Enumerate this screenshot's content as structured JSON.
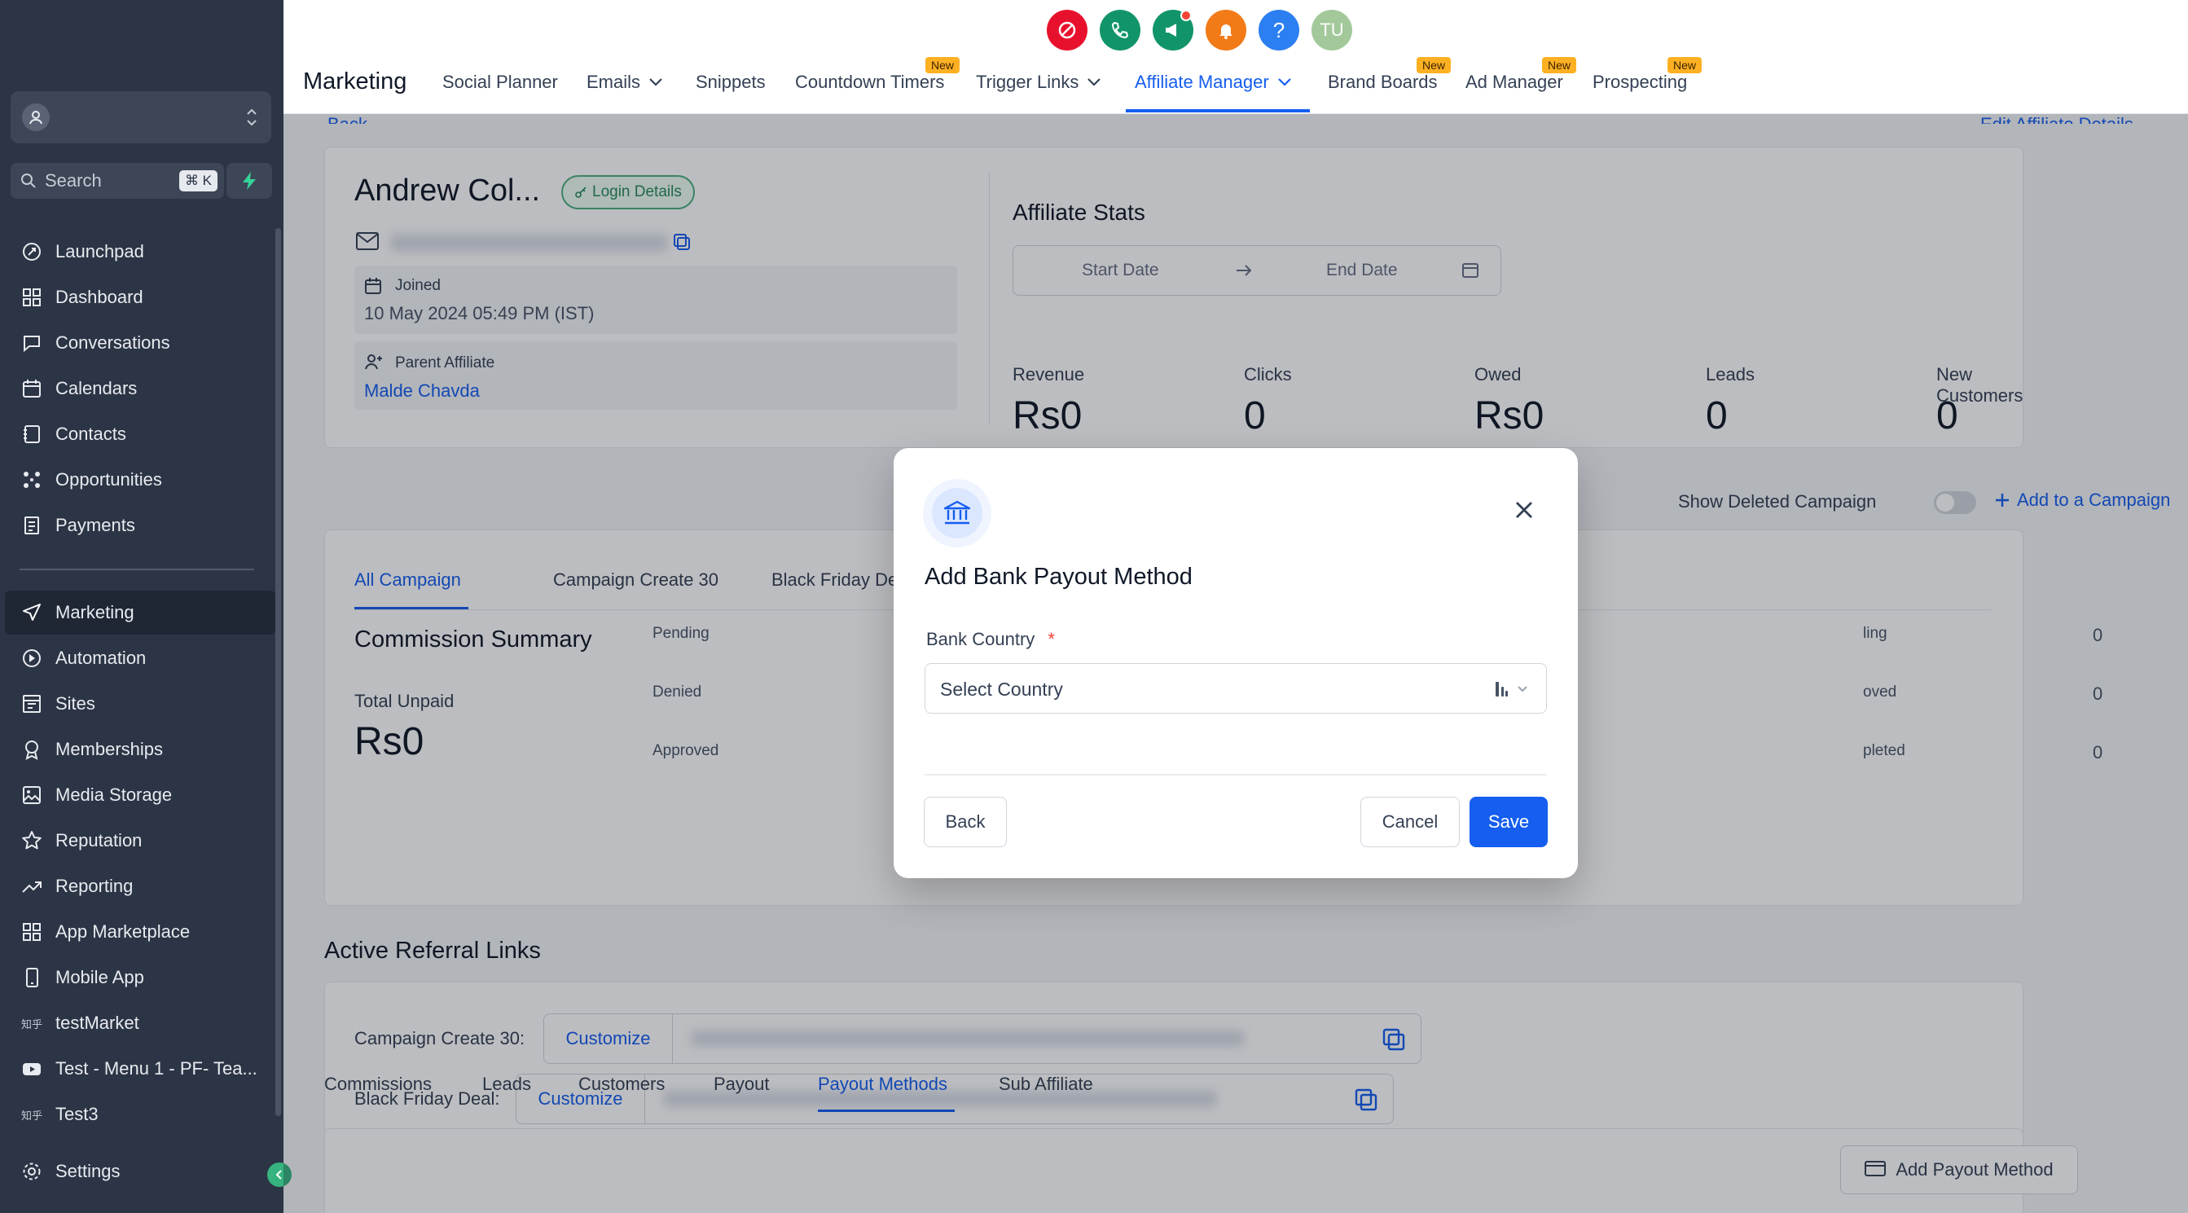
{
  "sidebar": {
    "search_label": "Search",
    "search_shortcut": "⌘ K",
    "items": [
      {
        "label": "Launchpad",
        "icon": "rocket-icon"
      },
      {
        "label": "Dashboard",
        "icon": "grid-icon"
      },
      {
        "label": "Conversations",
        "icon": "chat-icon"
      },
      {
        "label": "Calendars",
        "icon": "calendar-icon"
      },
      {
        "label": "Contacts",
        "icon": "contacts-icon"
      },
      {
        "label": "Opportunities",
        "icon": "opportunities-icon"
      },
      {
        "label": "Payments",
        "icon": "payments-icon"
      },
      {
        "label": "Marketing",
        "icon": "send-icon",
        "active": true
      },
      {
        "label": "Automation",
        "icon": "automation-icon"
      },
      {
        "label": "Sites",
        "icon": "sites-icon"
      },
      {
        "label": "Memberships",
        "icon": "memberships-icon"
      },
      {
        "label": "Media Storage",
        "icon": "image-icon"
      },
      {
        "label": "Reputation",
        "icon": "star-icon"
      },
      {
        "label": "Reporting",
        "icon": "trend-icon"
      },
      {
        "label": "App Marketplace",
        "icon": "apps-icon"
      },
      {
        "label": "Mobile App",
        "icon": "mobile-icon"
      },
      {
        "label": "testMarket",
        "icon": "text-icon"
      },
      {
        "label": "Test - Menu 1 - PF- Tea...",
        "icon": "youtube-icon"
      },
      {
        "label": "Test3",
        "icon": "text-icon"
      }
    ],
    "settings_label": "Settings",
    "chinese_glyph": "知乎"
  },
  "topnav": {
    "module_title": "Marketing",
    "tabs": [
      {
        "label": "Social Planner"
      },
      {
        "label": "Emails",
        "dropdown": true
      },
      {
        "label": "Snippets"
      },
      {
        "label": "Countdown Timers",
        "badge": "New"
      },
      {
        "label": "Trigger Links",
        "dropdown": true
      },
      {
        "label": "Affiliate Manager",
        "dropdown": true,
        "active": true
      },
      {
        "label": "Brand Boards",
        "badge": "New"
      },
      {
        "label": "Ad Manager",
        "badge": "New"
      },
      {
        "label": "Prospecting",
        "badge": "New"
      }
    ],
    "avatar_initials": "TU",
    "help_glyph": "?"
  },
  "page": {
    "back_label": "Back",
    "edit_label": "Edit Affiliate Details",
    "affiliate_name": "Andrew Col...",
    "login_details_label": "Login Details",
    "joined_label": "Joined",
    "joined_value": "10 May 2024 05:49 PM (IST)",
    "parent_label": "Parent Affiliate",
    "parent_value": "Malde Chavda",
    "stats_title": "Affiliate Stats",
    "start_date_placeholder": "Start Date",
    "end_date_placeholder": "End Date",
    "stats": [
      {
        "label": "Revenue",
        "value": "Rs0"
      },
      {
        "label": "Clicks",
        "value": "0"
      },
      {
        "label": "Owed",
        "value": "Rs0"
      },
      {
        "label": "Leads",
        "value": "0"
      },
      {
        "label": "New Customers",
        "value": "0"
      }
    ],
    "show_deleted_label": "Show Deleted Campaign",
    "add_campaign_label": "Add to a Campaign",
    "campaign_tabs": [
      "All Campaign",
      "Campaign Create 30",
      "Black Friday Deal"
    ],
    "commission_title": "Commission Summary",
    "total_unpaid_label": "Total Unpaid",
    "total_unpaid_value": "Rs0",
    "commission_left": [
      "Pending",
      "Denied",
      "Approved"
    ],
    "commission_right": [
      {
        "label": "ling",
        "value": "0"
      },
      {
        "label": "oved",
        "value": "0"
      },
      {
        "label": "pleted",
        "value": "0"
      }
    ],
    "referral_title": "Active Referral Links",
    "referral_links": [
      {
        "label": "Campaign Create 30:",
        "button": "Customize"
      },
      {
        "label": "Black Friday Deal:",
        "button": "Customize"
      }
    ],
    "bottom_tabs": [
      "Commissions",
      "Leads",
      "Customers",
      "Payout",
      "Payout Methods",
      "Sub Affiliate"
    ],
    "add_payout_label": "Add Payout Method"
  },
  "modal": {
    "title": "Add Bank Payout Method",
    "field_label": "Bank Country",
    "required_mark": "*",
    "select_placeholder": "Select Country",
    "back_button": "Back",
    "cancel_button": "Cancel",
    "save_button": "Save"
  },
  "colors": {
    "accent": "#155eef",
    "sidebar_bg": "#2c3545",
    "new_badge": "#fdb022"
  }
}
